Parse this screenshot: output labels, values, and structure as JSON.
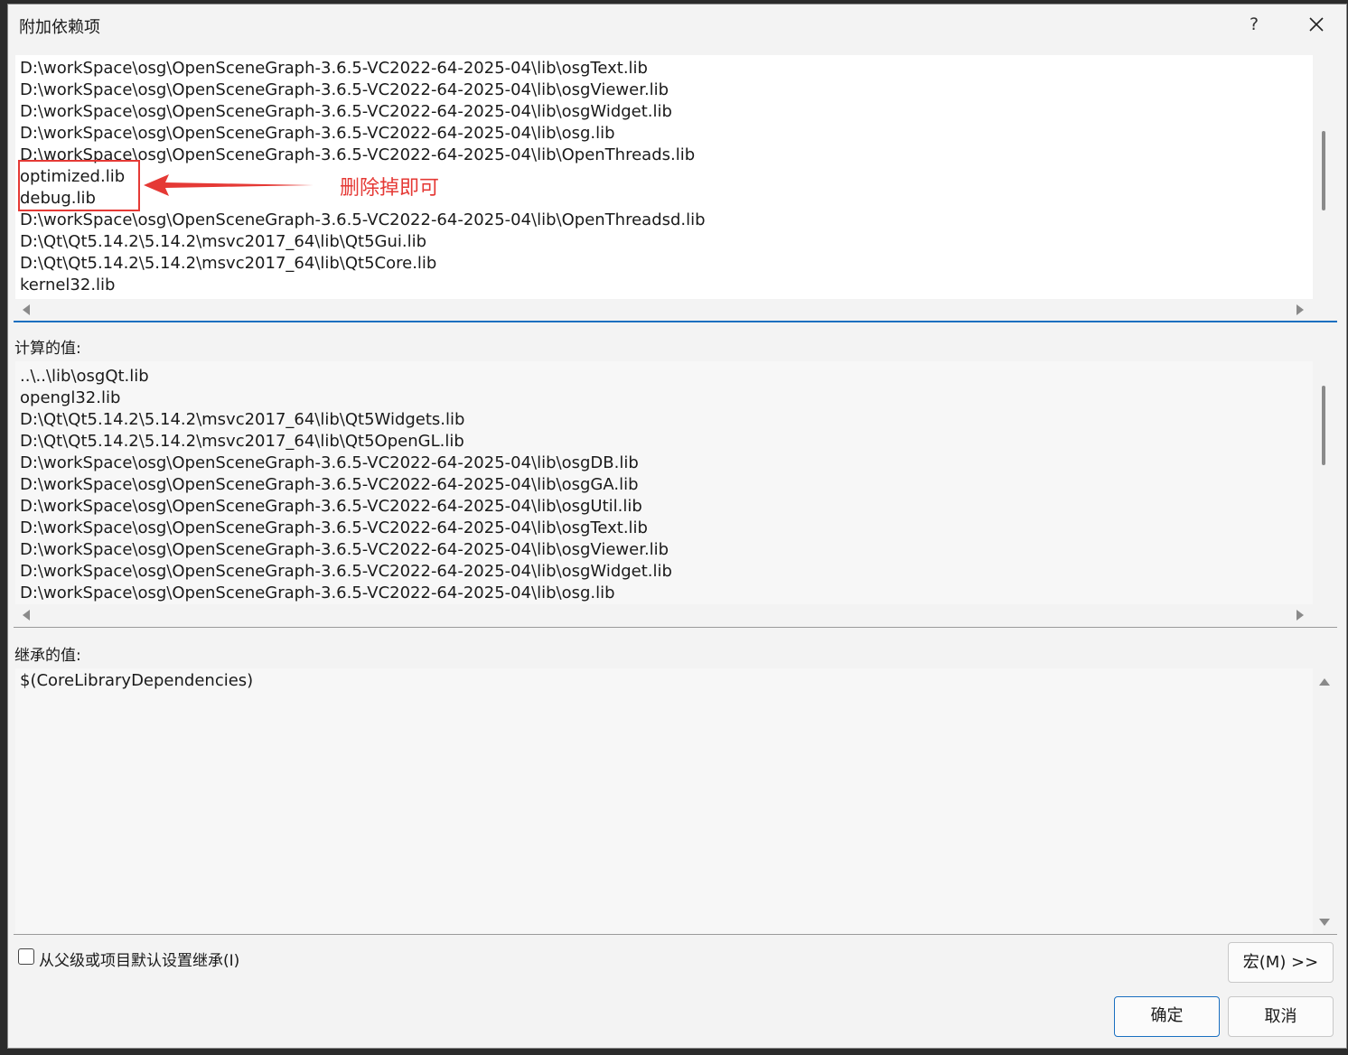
{
  "dialog": {
    "title": "附加依赖项",
    "help_label": "?"
  },
  "editor": {
    "lines": [
      "D:\\workSpace\\osg\\OpenSceneGraph-3.6.5-VC2022-64-2025-04\\lib\\osgText.lib",
      "D:\\workSpace\\osg\\OpenSceneGraph-3.6.5-VC2022-64-2025-04\\lib\\osgViewer.lib",
      "D:\\workSpace\\osg\\OpenSceneGraph-3.6.5-VC2022-64-2025-04\\lib\\osgWidget.lib",
      "D:\\workSpace\\osg\\OpenSceneGraph-3.6.5-VC2022-64-2025-04\\lib\\osg.lib",
      "D:\\workSpace\\osg\\OpenSceneGraph-3.6.5-VC2022-64-2025-04\\lib\\OpenThreads.lib",
      "optimized.lib",
      "debug.lib",
      "D:\\workSpace\\osg\\OpenSceneGraph-3.6.5-VC2022-64-2025-04\\lib\\OpenThreadsd.lib",
      "D:\\Qt\\Qt5.14.2\\5.14.2\\msvc2017_64\\lib\\Qt5Gui.lib",
      "D:\\Qt\\Qt5.14.2\\5.14.2\\msvc2017_64\\lib\\Qt5Core.lib",
      "kernel32.lib"
    ]
  },
  "annotation": {
    "text": "删除掉即可",
    "color": "#e53935"
  },
  "computed": {
    "label": "计算的值:",
    "lines": [
      "..\\..\\lib\\osgQt.lib",
      "opengl32.lib",
      "D:\\Qt\\Qt5.14.2\\5.14.2\\msvc2017_64\\lib\\Qt5Widgets.lib",
      "D:\\Qt\\Qt5.14.2\\5.14.2\\msvc2017_64\\lib\\Qt5OpenGL.lib",
      "D:\\workSpace\\osg\\OpenSceneGraph-3.6.5-VC2022-64-2025-04\\lib\\osgDB.lib",
      "D:\\workSpace\\osg\\OpenSceneGraph-3.6.5-VC2022-64-2025-04\\lib\\osgGA.lib",
      "D:\\workSpace\\osg\\OpenSceneGraph-3.6.5-VC2022-64-2025-04\\lib\\osgUtil.lib",
      "D:\\workSpace\\osg\\OpenSceneGraph-3.6.5-VC2022-64-2025-04\\lib\\osgText.lib",
      "D:\\workSpace\\osg\\OpenSceneGraph-3.6.5-VC2022-64-2025-04\\lib\\osgViewer.lib",
      "D:\\workSpace\\osg\\OpenSceneGraph-3.6.5-VC2022-64-2025-04\\lib\\osgWidget.lib",
      "D:\\workSpace\\osg\\OpenSceneGraph-3.6.5-VC2022-64-2025-04\\lib\\osg.lib"
    ]
  },
  "inherited": {
    "label": "继承的值:",
    "lines": [
      "$(CoreLibraryDependencies)"
    ]
  },
  "inherit_checkbox": {
    "label": "从父级或项目默认设置继承(I)",
    "checked": false
  },
  "buttons": {
    "macro": "宏(M) >>",
    "ok": "确定",
    "cancel": "取消"
  },
  "colors": {
    "accent": "#1a6fc0",
    "annotation_red": "#e53935",
    "dialog_bg": "#f3f3f3"
  }
}
